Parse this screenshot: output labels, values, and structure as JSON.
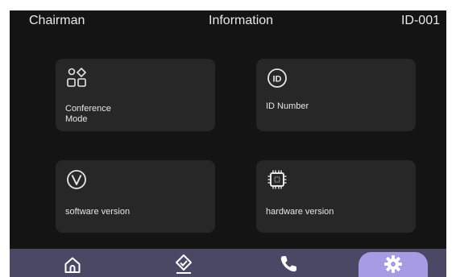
{
  "header": {
    "left": "Chairman",
    "title": "Information",
    "device_id": "ID-001"
  },
  "tiles": [
    {
      "label": "Conference\nMode",
      "icon": "shapes-icon"
    },
    {
      "label": "ID Number",
      "icon": "id-icon"
    },
    {
      "label": "software version",
      "icon": "version-icon"
    },
    {
      "label": "hardware version",
      "icon": "chip-icon"
    }
  ],
  "bottom_nav": {
    "items": [
      "home-icon",
      "checklist-icon",
      "phone-icon",
      "gear-icon"
    ],
    "active": "gear-icon"
  },
  "colors": {
    "background": "#141414",
    "tile": "#272727",
    "navbar": "#4b4866",
    "active_tab": "#a79be3",
    "text": "#e9e9e9"
  }
}
